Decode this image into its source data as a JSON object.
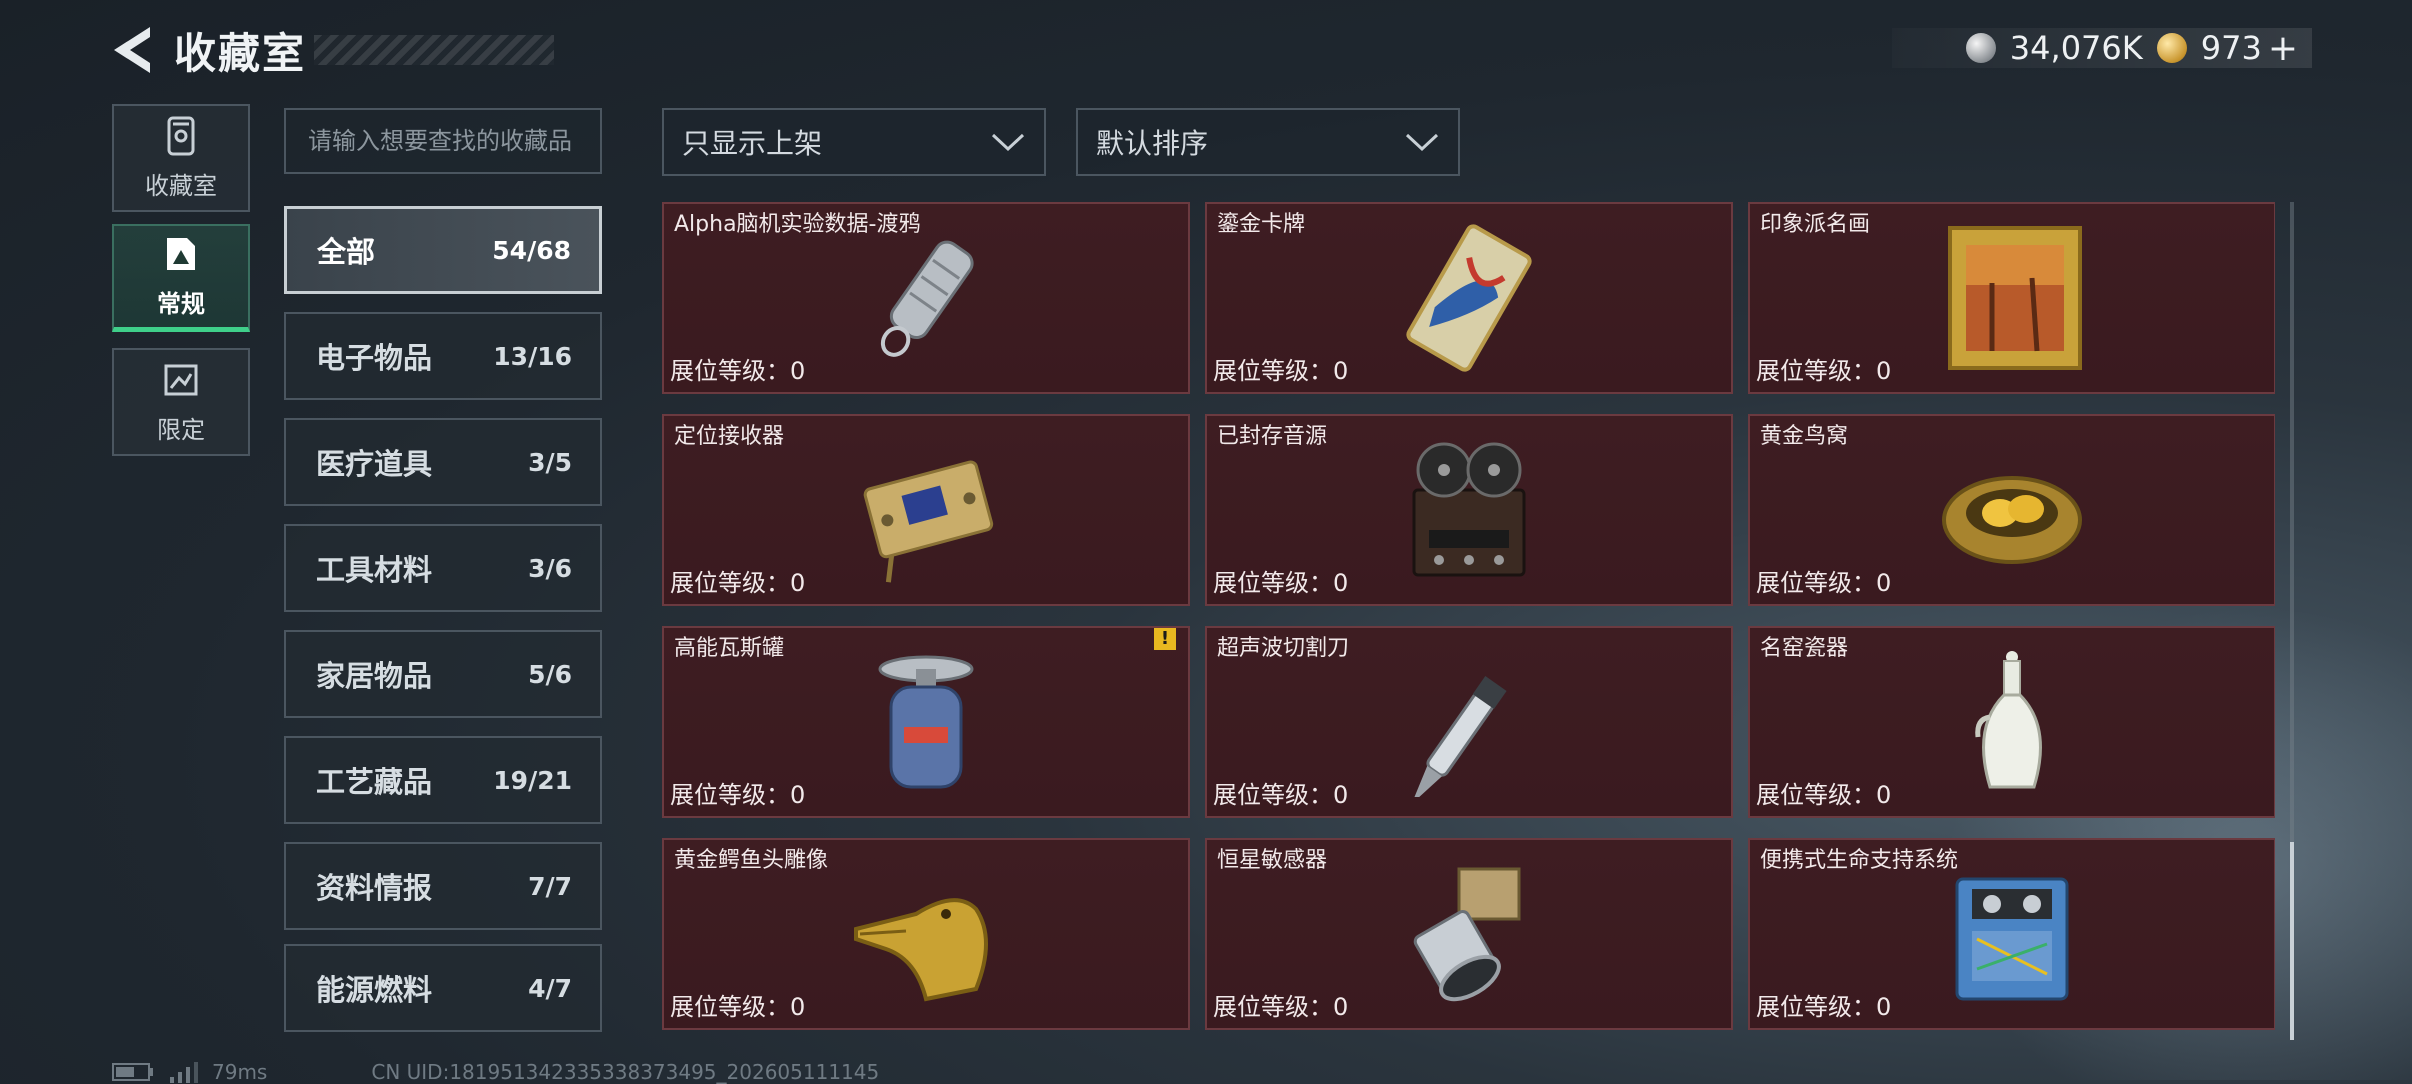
{
  "header": {
    "title": "收藏室"
  },
  "currency": [
    {
      "icon": "silver-coin-icon",
      "value": "34,076K"
    },
    {
      "icon": "gold-coin-icon",
      "value": "973"
    }
  ],
  "side_tabs": [
    {
      "label": "收藏室",
      "icon": "collection-room-icon",
      "active": false
    },
    {
      "label": "常规",
      "icon": "regular-card-icon",
      "active": true
    },
    {
      "label": "限定",
      "icon": "limited-icon",
      "active": false
    }
  ],
  "search": {
    "placeholder": "请输入想要查找的收藏品"
  },
  "filters": {
    "display": "只显示上架",
    "sort": "默认排序"
  },
  "categories": [
    {
      "label": "全部",
      "count": "54/68",
      "active": true
    },
    {
      "label": "电子物品",
      "count": "13/16"
    },
    {
      "label": "医疗道具",
      "count": "3/5"
    },
    {
      "label": "工具材料",
      "count": "3/6"
    },
    {
      "label": "家居物品",
      "count": "5/6"
    },
    {
      "label": "工艺藏品",
      "count": "19/21"
    },
    {
      "label": "资料情报",
      "count": "7/7"
    },
    {
      "label": "能源燃料",
      "count": "4/7"
    }
  ],
  "items": [
    {
      "name": "Alpha脑机实验数据-渡鸦",
      "level": "展位等级：0",
      "icon": "silver-data-canister-icon"
    },
    {
      "name": "鎏金卡牌",
      "level": "展位等级：0",
      "icon": "gilded-card-icon"
    },
    {
      "name": "印象派名画",
      "level": "展位等级：0",
      "icon": "framed-painting-icon"
    },
    {
      "name": "定位接收器",
      "level": "展位等级：0",
      "icon": "locator-receiver-icon"
    },
    {
      "name": "已封存音源",
      "level": "展位等级：0",
      "icon": "reel-tape-recorder-icon"
    },
    {
      "name": "黄金鸟窝",
      "level": "展位等级：0",
      "icon": "golden-nest-icon"
    },
    {
      "name": "高能瓦斯罐",
      "level": "展位等级：0",
      "icon": "gas-canister-icon",
      "warning": "!"
    },
    {
      "name": "超声波切割刀",
      "level": "展位等级：0",
      "icon": "ultrasonic-cutter-icon"
    },
    {
      "name": "名窑瓷器",
      "level": "展位等级：0",
      "icon": "porcelain-vase-icon"
    },
    {
      "name": "黄金鳄鱼头雕像",
      "level": "展位等级：0",
      "icon": "golden-crocodile-head-icon"
    },
    {
      "name": "恒星敏感器",
      "level": "展位等级：0",
      "icon": "star-sensor-icon"
    },
    {
      "name": "便携式生命支持系统",
      "level": "展位等级：0",
      "icon": "life-support-system-icon"
    }
  ],
  "footer": {
    "ping": "79ms",
    "uid": "CN UID:18195134233533837349​5_202605111145"
  },
  "colors": {
    "card_bg": "#3c1c21",
    "active_tab_accent": "#3fd08a",
    "warning": "#e8b820"
  }
}
